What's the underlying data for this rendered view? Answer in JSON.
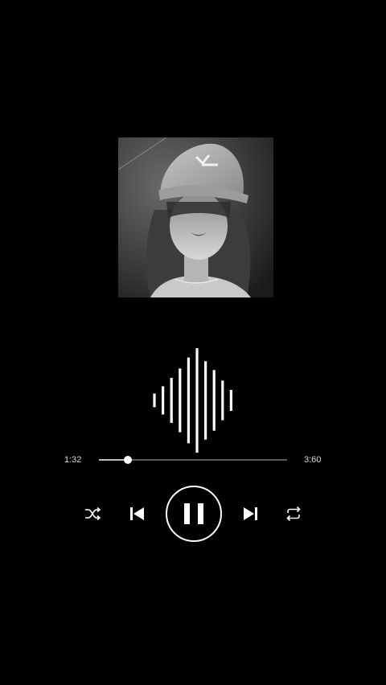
{
  "player": {
    "elapsed": "1:32",
    "duration": "3:60",
    "progress": 0.155,
    "state": "playing"
  },
  "album_art": {
    "description_icon": "album-cover"
  },
  "waveform": {
    "levels": [
      0.13,
      0.27,
      0.43,
      0.61,
      0.82,
      1.0,
      0.75,
      0.58,
      0.38,
      0.2
    ]
  },
  "controls": {
    "shuffle_icon": "shuffle-icon",
    "prev_icon": "skip-previous-icon",
    "play_pause_icon": "pause-icon",
    "next_icon": "skip-next-icon",
    "repeat_icon": "repeat-icon"
  },
  "colors": {
    "background": "#000000",
    "foreground": "#ffffff",
    "track": "#5a5a5a",
    "track_fill": "#bdbdbd"
  }
}
